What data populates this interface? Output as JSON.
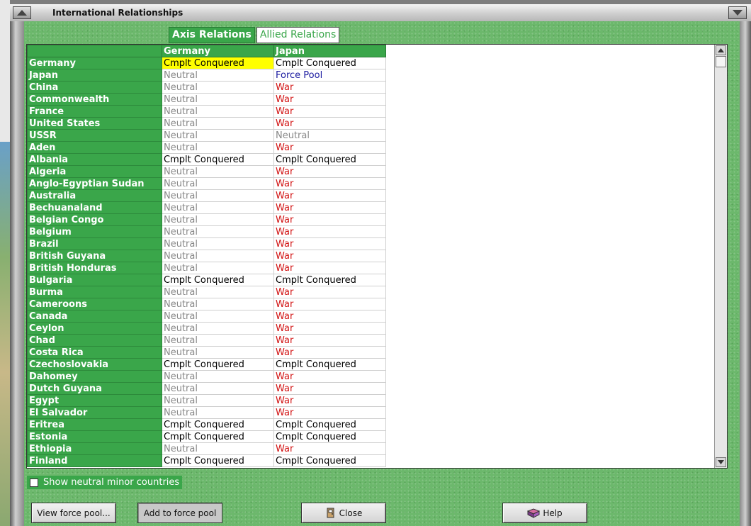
{
  "window": {
    "title": "International Relationships"
  },
  "tabs": [
    {
      "label": "Axis Relations",
      "active": true
    },
    {
      "label": "Allied Relations",
      "active": false
    }
  ],
  "table": {
    "columns": [
      "Germany",
      "Japan"
    ],
    "rows": [
      {
        "country": "Germany",
        "germany": "Cmplt Conquered",
        "japan": "Cmplt Conquered",
        "highlight": "germany"
      },
      {
        "country": "Japan",
        "germany": "Neutral",
        "japan": "Force Pool"
      },
      {
        "country": "China",
        "germany": "Neutral",
        "japan": "War"
      },
      {
        "country": "Commonwealth",
        "germany": "Neutral",
        "japan": "War"
      },
      {
        "country": "France",
        "germany": "Neutral",
        "japan": "War"
      },
      {
        "country": "United States",
        "germany": "Neutral",
        "japan": "War"
      },
      {
        "country": "USSR",
        "germany": "Neutral",
        "japan": "Neutral"
      },
      {
        "country": "Aden",
        "germany": "Neutral",
        "japan": "War"
      },
      {
        "country": "Albania",
        "germany": "Cmplt Conquered",
        "japan": "Cmplt Conquered"
      },
      {
        "country": "Algeria",
        "germany": "Neutral",
        "japan": "War"
      },
      {
        "country": "Anglo-Egyptian Sudan",
        "germany": "Neutral",
        "japan": "War"
      },
      {
        "country": "Australia",
        "germany": "Neutral",
        "japan": "War"
      },
      {
        "country": "Bechuanaland",
        "germany": "Neutral",
        "japan": "War"
      },
      {
        "country": "Belgian Congo",
        "germany": "Neutral",
        "japan": "War"
      },
      {
        "country": "Belgium",
        "germany": "Neutral",
        "japan": "War"
      },
      {
        "country": "Brazil",
        "germany": "Neutral",
        "japan": "War"
      },
      {
        "country": "British Guyana",
        "germany": "Neutral",
        "japan": "War"
      },
      {
        "country": "British Honduras",
        "germany": "Neutral",
        "japan": "War"
      },
      {
        "country": "Bulgaria",
        "germany": "Cmplt Conquered",
        "japan": "Cmplt Conquered"
      },
      {
        "country": "Burma",
        "germany": "Neutral",
        "japan": "War"
      },
      {
        "country": "Cameroons",
        "germany": "Neutral",
        "japan": "War"
      },
      {
        "country": "Canada",
        "germany": "Neutral",
        "japan": "War"
      },
      {
        "country": "Ceylon",
        "germany": "Neutral",
        "japan": "War"
      },
      {
        "country": "Chad",
        "germany": "Neutral",
        "japan": "War"
      },
      {
        "country": "Costa Rica",
        "germany": "Neutral",
        "japan": "War"
      },
      {
        "country": "Czechoslovakia",
        "germany": "Cmplt Conquered",
        "japan": "Cmplt Conquered"
      },
      {
        "country": "Dahomey",
        "germany": "Neutral",
        "japan": "War"
      },
      {
        "country": "Dutch Guyana",
        "germany": "Neutral",
        "japan": "War"
      },
      {
        "country": "Egypt",
        "germany": "Neutral",
        "japan": "War"
      },
      {
        "country": "El Salvador",
        "germany": "Neutral",
        "japan": "War"
      },
      {
        "country": "Eritrea",
        "germany": "Cmplt Conquered",
        "japan": "Cmplt Conquered"
      },
      {
        "country": "Estonia",
        "germany": "Cmplt Conquered",
        "japan": "Cmplt Conquered"
      },
      {
        "country": "Ethiopia",
        "germany": "Neutral",
        "japan": "War"
      },
      {
        "country": "Finland",
        "germany": "Cmplt Conquered",
        "japan": "Cmplt Conquered"
      }
    ]
  },
  "checkbox": {
    "label": "Show neutral minor countries",
    "checked": false
  },
  "buttons": {
    "view_force_pool": "View force pool...",
    "add_to_force_pool": "Add to force pool",
    "close": "Close",
    "help": "Help"
  },
  "colors": {
    "header_green": "#3aa64a",
    "war": "#d21414",
    "neutral": "#888888",
    "force_pool": "#1a1aa0",
    "highlight": "#ffff00"
  }
}
